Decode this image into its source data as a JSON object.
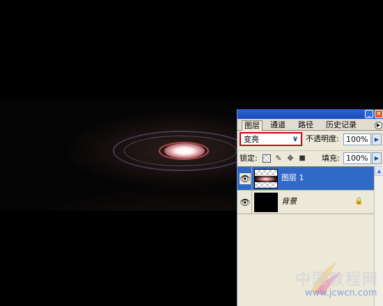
{
  "window": {
    "minimize_icon": "minimize-icon",
    "close_icon": "close-icon"
  },
  "tabs": [
    {
      "label": "图层",
      "active": true
    },
    {
      "label": "通道",
      "active": false
    },
    {
      "label": "路径",
      "active": false
    },
    {
      "label": "历史记录",
      "active": false
    }
  ],
  "blend": {
    "mode": "变亮",
    "opacity_label": "不透明度:",
    "opacity_value": "100%"
  },
  "lock": {
    "label": "锁定:",
    "icons": [
      "lock-transparent-icon",
      "lock-paint-icon",
      "lock-move-icon",
      "lock-all-icon"
    ],
    "fill_label": "填充:",
    "fill_value": "100%"
  },
  "layers": [
    {
      "name": "图层 1",
      "selected": true,
      "visible": true,
      "locked": false
    },
    {
      "name": "背景",
      "selected": false,
      "visible": true,
      "locked": true
    }
  ],
  "watermark": {
    "title": "中国教程网",
    "url": "www.jcwcn.com"
  },
  "colors": {
    "panel_bg": "#ece9d8",
    "selection": "#3169c6",
    "highlight_border": "#d00010",
    "titlebar": "#2b63d8"
  }
}
